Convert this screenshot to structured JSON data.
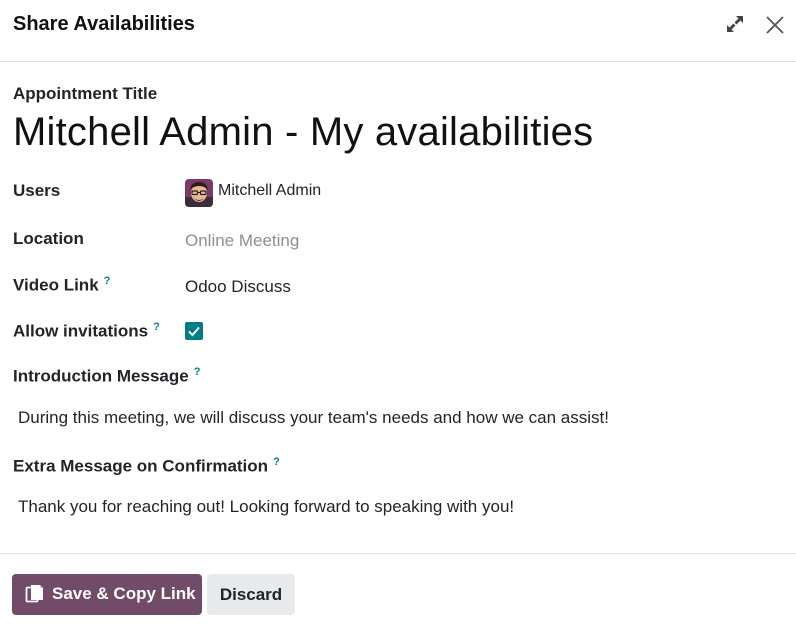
{
  "dialog": {
    "title": "Share Availabilities"
  },
  "form": {
    "appointment_title_label": "Appointment Title",
    "appointment_title_value": "Mitchell Admin - My availabilities",
    "users_label": "Users",
    "users_value": "Mitchell Admin",
    "location_label": "Location",
    "location_placeholder": "Online Meeting",
    "video_link_label": "Video Link",
    "video_link_value": "Odoo Discuss",
    "allow_invitations_label": "Allow invitations",
    "allow_invitations_checked": true,
    "intro_label": "Introduction Message",
    "intro_value": "During this meeting, we will discuss your team's needs and how we can assist!",
    "extra_label": "Extra Message on Confirmation",
    "extra_value": "Thank you for reaching out! Looking forward to speaking with you!",
    "help_mark": "?"
  },
  "footer": {
    "save_label": "Save & Copy Link",
    "discard_label": "Discard"
  },
  "colors": {
    "primary": "#714b67",
    "accent": "#017e84",
    "secondary_bg": "#e7e9ed"
  },
  "icons": {
    "expand": "expand-icon",
    "close": "close-icon",
    "copy": "copy-icon",
    "check": "check-icon",
    "avatar": "user-avatar"
  }
}
